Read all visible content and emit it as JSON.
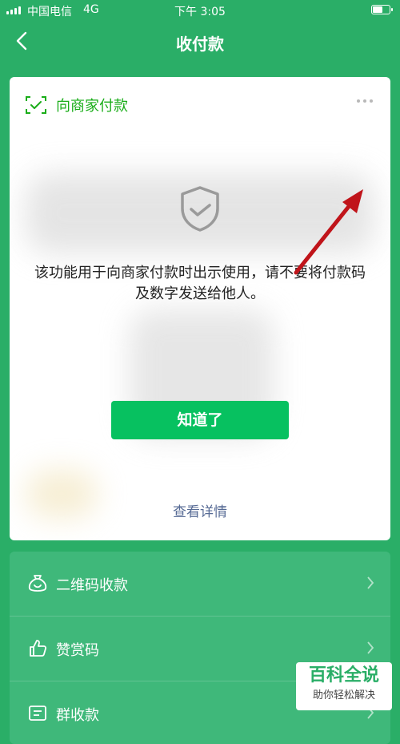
{
  "status": {
    "carrier": "中国电信",
    "network": "4G",
    "time": "下午 3:05"
  },
  "nav": {
    "title": "收付款"
  },
  "card": {
    "title": "向商家付款",
    "notice": "该功能用于向商家付款时出示使用，请不要将付款码及数字发送给他人。",
    "ok_button": "知道了",
    "details_link": "查看详情"
  },
  "list": {
    "items": [
      {
        "label": "二维码收款",
        "icon": "money-bag-icon"
      },
      {
        "label": "赞赏码",
        "icon": "thumbs-up-icon"
      },
      {
        "label": "群收款",
        "icon": "group-collect-icon"
      }
    ]
  },
  "watermark": {
    "title": "百科全说",
    "subtitle": "助你轻松解决"
  },
  "colors": {
    "primary": "#2aae67",
    "button": "#07c160",
    "link": "#576b95",
    "arrow": "#c0141a"
  }
}
